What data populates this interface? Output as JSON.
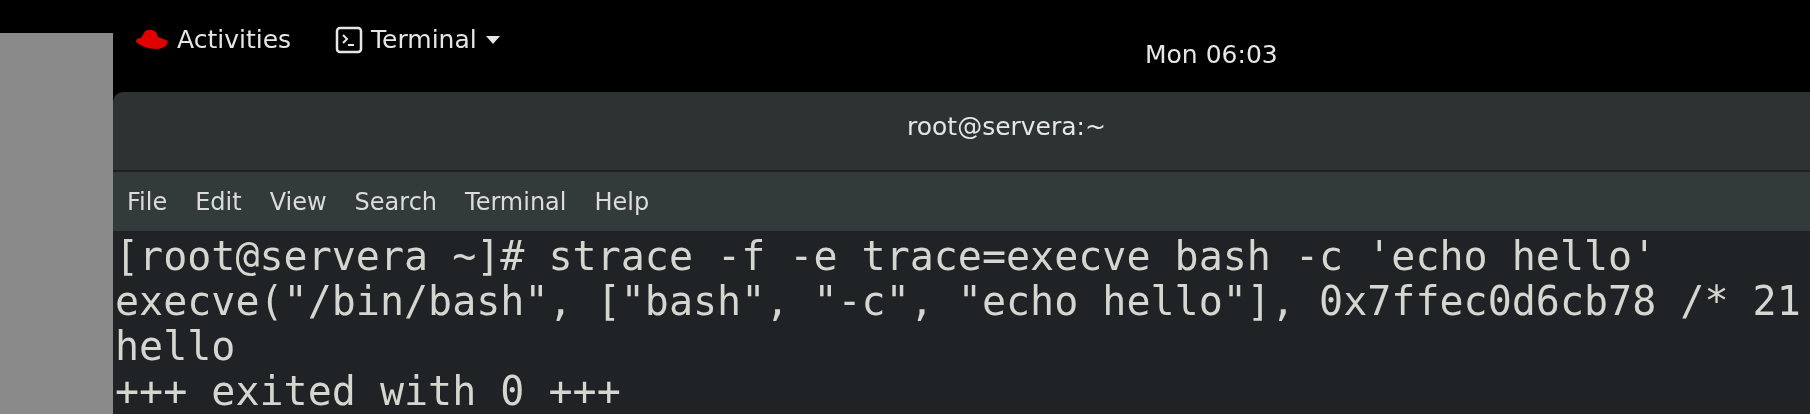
{
  "top_bar": {
    "activities": "Activities",
    "app_menu": "Terminal",
    "clock": "Mon 06:03"
  },
  "window": {
    "title": "root@servera:~",
    "menu": [
      "File",
      "Edit",
      "View",
      "Search",
      "Terminal",
      "Help"
    ],
    "terminal_lines": [
      "[root@servera ~]# strace -f -e trace=execve bash -c 'echo hello'",
      "execve(\"/bin/bash\", [\"bash\", \"-c\", \"echo hello\"], 0x7ffec0d6cb78 /* 21",
      "hello",
      "+++ exited with 0 +++"
    ]
  }
}
